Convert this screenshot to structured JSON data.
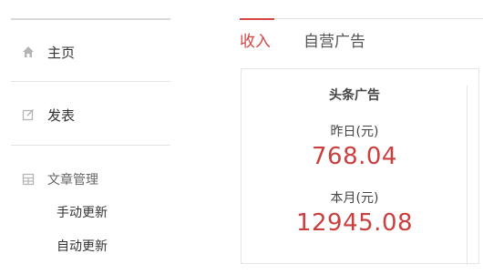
{
  "sidebar": {
    "items": [
      {
        "label": "主页",
        "icon": "home-icon"
      },
      {
        "label": "发表",
        "icon": "edit-icon"
      }
    ],
    "group": {
      "label": "文章管理",
      "icon": "article-icon",
      "children": [
        {
          "label": "手动更新"
        },
        {
          "label": "自动更新"
        }
      ]
    }
  },
  "tabs": [
    {
      "label": "收入",
      "active": true
    },
    {
      "label": "自营广告",
      "active": false
    }
  ],
  "card": {
    "title": "头条广告",
    "stats": [
      {
        "label": "昨日(元)",
        "value": "768.04"
      },
      {
        "label": "本月(元)",
        "value": "12945.08"
      }
    ]
  },
  "colors": {
    "accent": "#d64541",
    "value_red": "#c9403f",
    "icon_gray": "#b5b5b5"
  }
}
